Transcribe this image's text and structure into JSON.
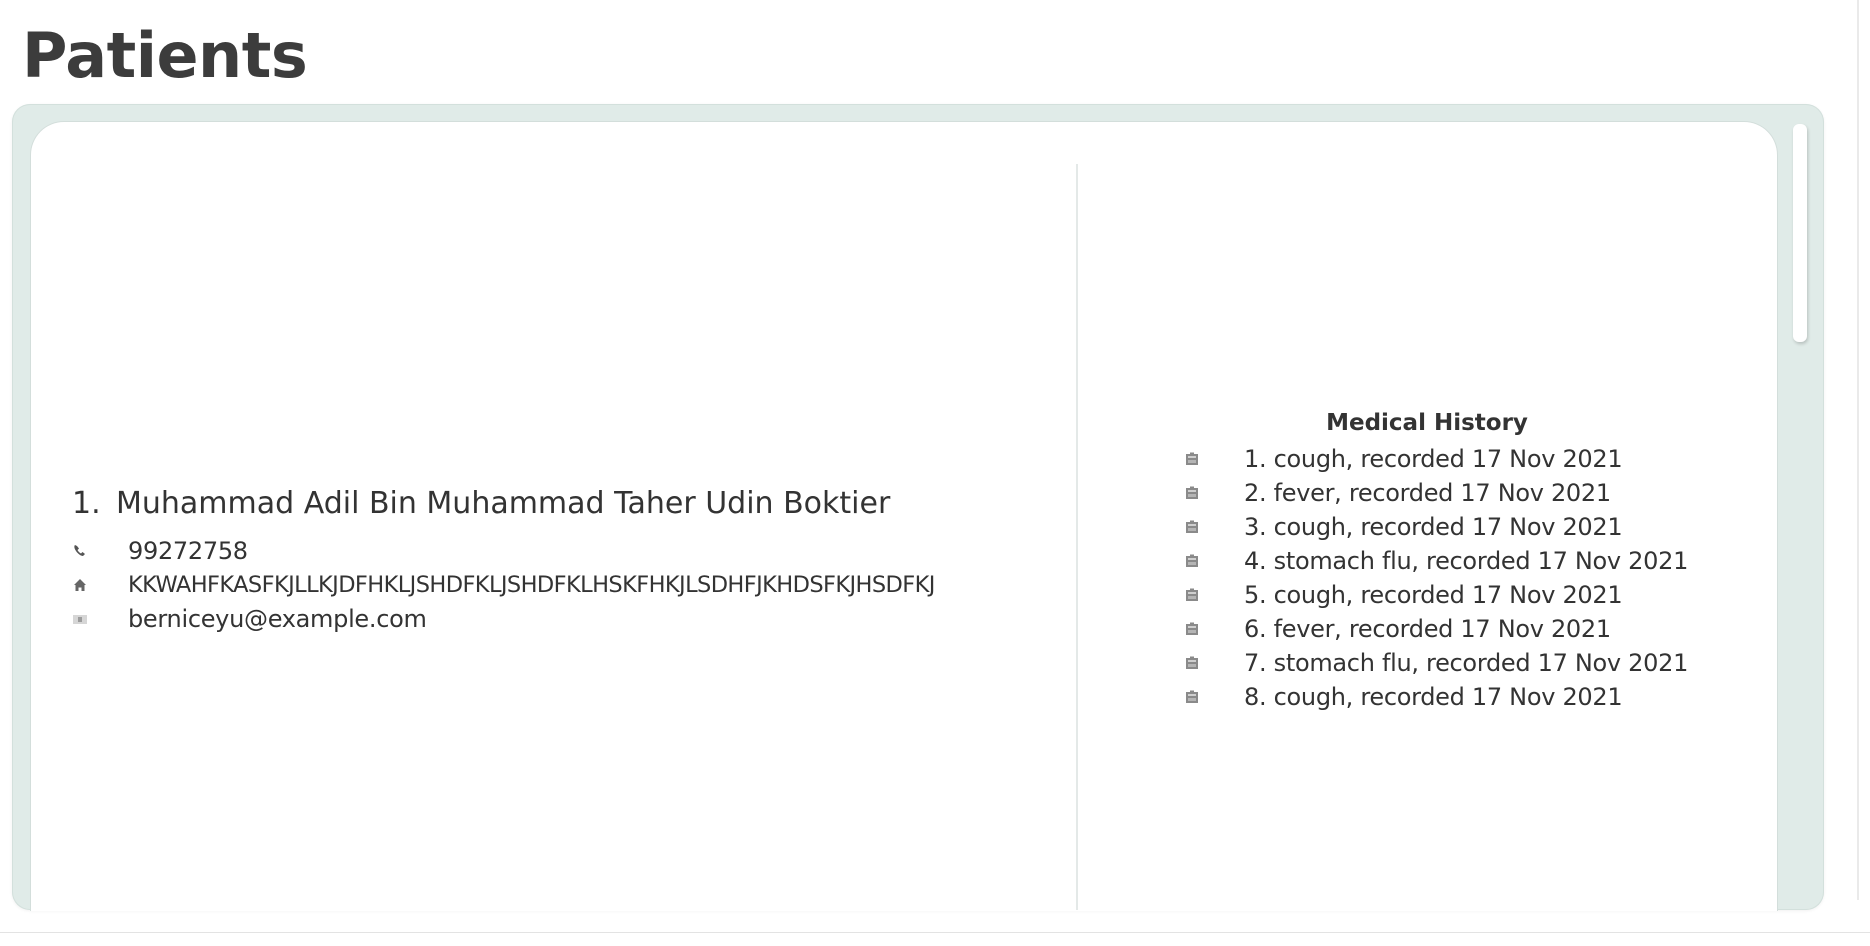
{
  "page": {
    "title": "Patients"
  },
  "patient": {
    "index": "1.",
    "name": "Muhammad Adil Bin Muhammad Taher Udin Boktier",
    "phone": "99272758",
    "address": "KKWAHFKASFKJLLKJDFHKLJSHDFKLJSHDFKLHSKFHKJLSDHFJKHDSFKJHSDFKJ",
    "email": "berniceyu@example.com",
    "icons": {
      "phone": "phone-icon",
      "address": "home-icon",
      "email": "email-icon"
    }
  },
  "medical_history": {
    "title": "Medical History",
    "icon": "medical-record-icon",
    "items": [
      "1. cough, recorded 17 Nov 2021",
      "2. fever, recorded 17 Nov 2021",
      "3. cough, recorded 17 Nov 2021",
      "4. stomach flu, recorded 17 Nov 2021",
      "5. cough, recorded 17 Nov 2021",
      "6. fever, recorded 17 Nov 2021",
      "7. stomach flu, recorded 17 Nov 2021",
      "8. cough, recorded 17 Nov 2021"
    ]
  },
  "colors": {
    "frame": "#e0ebe8",
    "text": "#333333",
    "title": "#3c3c3c"
  }
}
